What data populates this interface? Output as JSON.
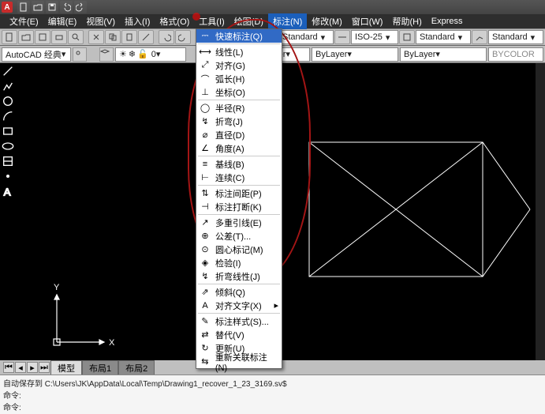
{
  "titlebar": {
    "app_letter": "A"
  },
  "menubar": {
    "items": [
      "文件(E)",
      "编辑(E)",
      "视图(V)",
      "插入(I)",
      "格式(O)",
      "工具(I)",
      "绘图(D)",
      "标注(N)",
      "修改(M)",
      "窗口(W)",
      "帮助(H)",
      "Express"
    ],
    "active_index": 7
  },
  "toolbar_top": {
    "combo_style": "Standard",
    "combo_dimstyle": "ISO-25",
    "combo_style2": "Standard",
    "combo_style3": "Standard"
  },
  "toolbar2": {
    "workspace": "AutoCAD 经典",
    "layer": "0",
    "bylayer1": "ByLayer",
    "bylayer2": "ByLayer",
    "bylayer3": "ByLayer",
    "bycolor": "BYCOLOR"
  },
  "dropdown": {
    "items": [
      {
        "label": "快速标注(Q)"
      },
      {
        "sep": true
      },
      {
        "label": "线性(L)"
      },
      {
        "label": "对齐(G)"
      },
      {
        "label": "弧长(H)"
      },
      {
        "label": "坐标(O)"
      },
      {
        "sep": true
      },
      {
        "label": "半径(R)"
      },
      {
        "label": "折弯(J)"
      },
      {
        "label": "直径(D)"
      },
      {
        "label": "角度(A)"
      },
      {
        "sep": true
      },
      {
        "label": "基线(B)"
      },
      {
        "label": "连续(C)"
      },
      {
        "sep": true
      },
      {
        "label": "标注间距(P)"
      },
      {
        "label": "标注打断(K)"
      },
      {
        "sep": true
      },
      {
        "label": "多重引线(E)"
      },
      {
        "label": "公差(T)..."
      },
      {
        "label": "圆心标记(M)"
      },
      {
        "label": "检验(I)"
      },
      {
        "label": "折弯线性(J)"
      },
      {
        "sep": true
      },
      {
        "label": "倾斜(Q)"
      },
      {
        "label": "对齐文字(X)",
        "arrow": true
      },
      {
        "sep": true
      },
      {
        "label": "标注样式(S)..."
      },
      {
        "label": "替代(V)"
      },
      {
        "label": "更新(U)"
      },
      {
        "label": "重新关联标注(N)"
      }
    ],
    "highlight_index": 0
  },
  "ucs": {
    "x": "X",
    "y": "Y"
  },
  "bottom_tabs": {
    "model": "模型",
    "layout1": "布局1",
    "layout2": "布局2"
  },
  "cmdline": {
    "line1": "自动保存到 C:\\Users\\JK\\AppData\\Local\\Temp\\Drawing1_recover_1_23_3169.sv$",
    "line2": "命令:",
    "line3": "命令:"
  }
}
